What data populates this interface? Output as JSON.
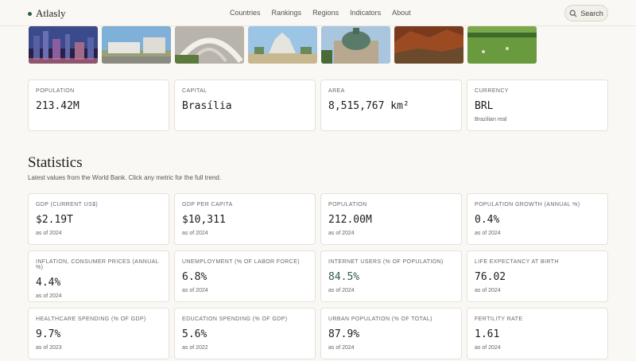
{
  "header": {
    "brand": "Atlasly",
    "nav": [
      "Countries",
      "Rankings",
      "Regions",
      "Indicators",
      "About"
    ],
    "search_label": "Search"
  },
  "photos": [
    "city-skyline-night",
    "modernist-buildings",
    "arched-concrete-structure",
    "cathedral-plaza",
    "historic-dome-building",
    "red-rock-cliffs",
    "green-pasture"
  ],
  "summary": [
    {
      "label": "POPULATION",
      "value": "213.42M",
      "sub": ""
    },
    {
      "label": "CAPITAL",
      "value": "Brasília",
      "sub": ""
    },
    {
      "label": "AREA",
      "value": "8,515,767 km²",
      "sub": ""
    },
    {
      "label": "CURRENCY",
      "value": "BRL",
      "sub": "Brazilian real"
    }
  ],
  "statistics": {
    "title": "Statistics",
    "description": "Latest values from the World Bank. Click any metric for the full trend.",
    "cards": [
      {
        "label": "GDP (CURRENT US$)",
        "value": "$2.19T",
        "sub": "as of 2024"
      },
      {
        "label": "GDP PER CAPITA",
        "value": "$10,311",
        "sub": "as of 2024"
      },
      {
        "label": "POPULATION",
        "value": "212.00M",
        "sub": "as of 2024"
      },
      {
        "label": "POPULATION GROWTH (ANNUAL %)",
        "value": "0.4%",
        "sub": "as of 2024"
      },
      {
        "label": "INFLATION, CONSUMER PRICES (ANNUAL %)",
        "value": "4.4%",
        "sub": "as of 2024"
      },
      {
        "label": "UNEMPLOYMENT (% OF LABOR FORCE)",
        "value": "6.8%",
        "sub": "as of 2024"
      },
      {
        "label": "INTERNET USERS (% OF POPULATION)",
        "value": "84.5%",
        "sub": "as of 2024"
      },
      {
        "label": "LIFE EXPECTANCY AT BIRTH",
        "value": "76.02",
        "sub": "as of 2024"
      },
      {
        "label": "HEALTHCARE SPENDING (% OF GDP)",
        "value": "9.7%",
        "sub": "as of 2023"
      },
      {
        "label": "EDUCATION SPENDING (% OF GDP)",
        "value": "5.6%",
        "sub": "as of 2022"
      },
      {
        "label": "URBAN POPULATION (% OF TOTAL)",
        "value": "87.9%",
        "sub": "as of 2024"
      },
      {
        "label": "FERTILITY RATE",
        "value": "1.61",
        "sub": "as of 2024"
      }
    ]
  }
}
